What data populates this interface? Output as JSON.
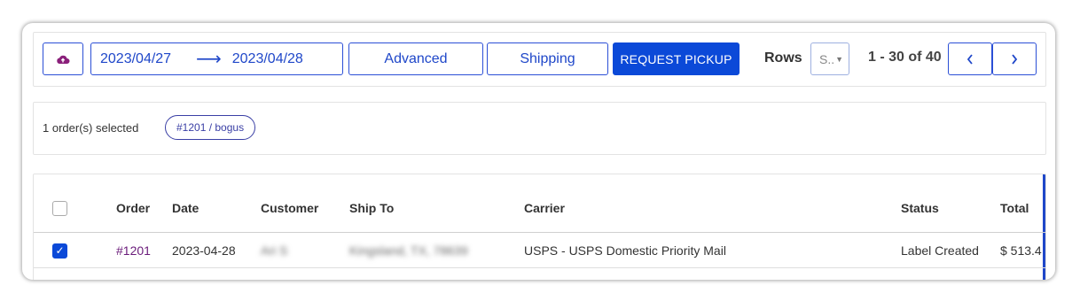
{
  "toolbar": {
    "date_from": "2023/04/27",
    "date_to": "2023/04/28",
    "advanced_label": "Advanced",
    "shipping_label": "Shipping",
    "request_pickup_label": "REQUEST PICKUP",
    "rows_label": "Rows",
    "rows_select_value": "S..",
    "pagination_text": "1 - 30 of 40",
    "cloud_icon": "cloud-upload-icon",
    "prev_icon": "chevron-left-icon",
    "next_icon": "chevron-right-icon"
  },
  "selection": {
    "summary": "1 order(s) selected",
    "chip_label": "#1201 / bogus"
  },
  "table": {
    "columns": [
      "Order",
      "Date",
      "Customer",
      "Ship To",
      "Carrier",
      "Status",
      "Total"
    ],
    "rows": [
      {
        "selected": true,
        "order": "#1201",
        "date": "2023-04-28",
        "customer": "Ari S",
        "ship_to": "Kingsland, TX, 78639",
        "carrier": "USPS - USPS Domestic Priority Mail",
        "status": "Label Created",
        "total": "$ 513.4"
      }
    ]
  },
  "colors": {
    "accent": "#0b49d8",
    "order_link": "#6a1b7a",
    "chip_border": "#3a3fa5"
  }
}
